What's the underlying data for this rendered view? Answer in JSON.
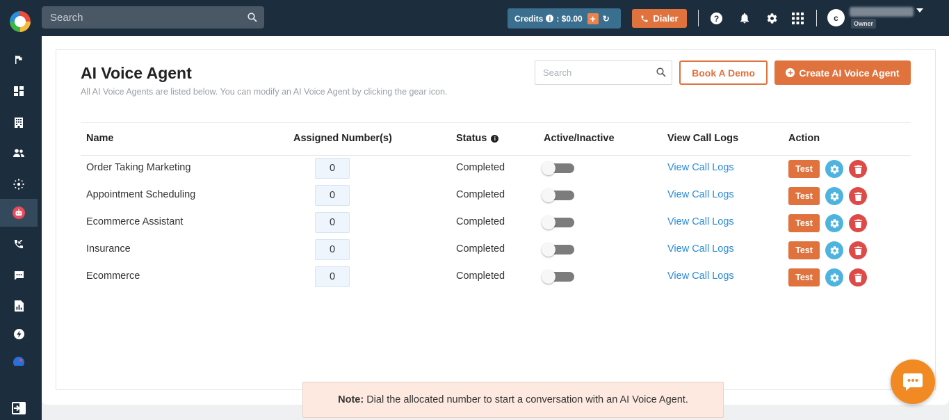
{
  "topbar": {
    "search_placeholder": "Search",
    "credits_label": "Credits",
    "credits_value": ": $0.00",
    "dialer_label": "Dialer",
    "avatar_initial": "c",
    "role_badge": "Owner"
  },
  "sidebar": {
    "items": [
      {
        "icon": "flag-icon"
      },
      {
        "icon": "dashboard-icon"
      },
      {
        "icon": "building-icon"
      },
      {
        "icon": "contacts-icon"
      },
      {
        "icon": "hub-icon"
      },
      {
        "icon": "robot-icon",
        "active": true
      },
      {
        "icon": "call-forward-icon"
      },
      {
        "icon": "chat-icon"
      },
      {
        "icon": "report-icon"
      },
      {
        "icon": "bolt-icon"
      },
      {
        "icon": "logout-icon"
      }
    ]
  },
  "page": {
    "title": "AI Voice Agent",
    "description": "All AI Voice Agents are listed below. You can modify an AI Voice Agent by clicking the gear icon.",
    "search_placeholder": "Search",
    "book_demo_label": "Book A Demo",
    "create_label": "Create AI Voice Agent"
  },
  "table": {
    "headers": {
      "name": "Name",
      "assigned": "Assigned Number(s)",
      "status": "Status",
      "active": "Active/Inactive",
      "logs": "View Call Logs",
      "action": "Action"
    },
    "rows": [
      {
        "name": "Order Taking Marketing",
        "assigned": "0",
        "status": "Completed",
        "logs": "View Call Logs",
        "test": "Test"
      },
      {
        "name": "Appointment Scheduling",
        "assigned": "0",
        "status": "Completed",
        "logs": "View Call Logs",
        "test": "Test"
      },
      {
        "name": "Ecommerce Assistant",
        "assigned": "0",
        "status": "Completed",
        "logs": "View Call Logs",
        "test": "Test"
      },
      {
        "name": "Insurance",
        "assigned": "0",
        "status": "Completed",
        "logs": "View Call Logs",
        "test": "Test"
      },
      {
        "name": "Ecommerce",
        "assigned": "0",
        "status": "Completed",
        "logs": "View Call Logs",
        "test": "Test"
      }
    ]
  },
  "note": {
    "label": "Note:",
    "text": "Dial the allocated number to start a conversation with an AI Voice Agent."
  },
  "colors": {
    "topbar_bg": "#1c2d3d",
    "accent_orange": "#e0723e",
    "link_blue": "#2b8bd8",
    "gear_blue": "#4fb3e0",
    "delete_red": "#dd4a48"
  }
}
